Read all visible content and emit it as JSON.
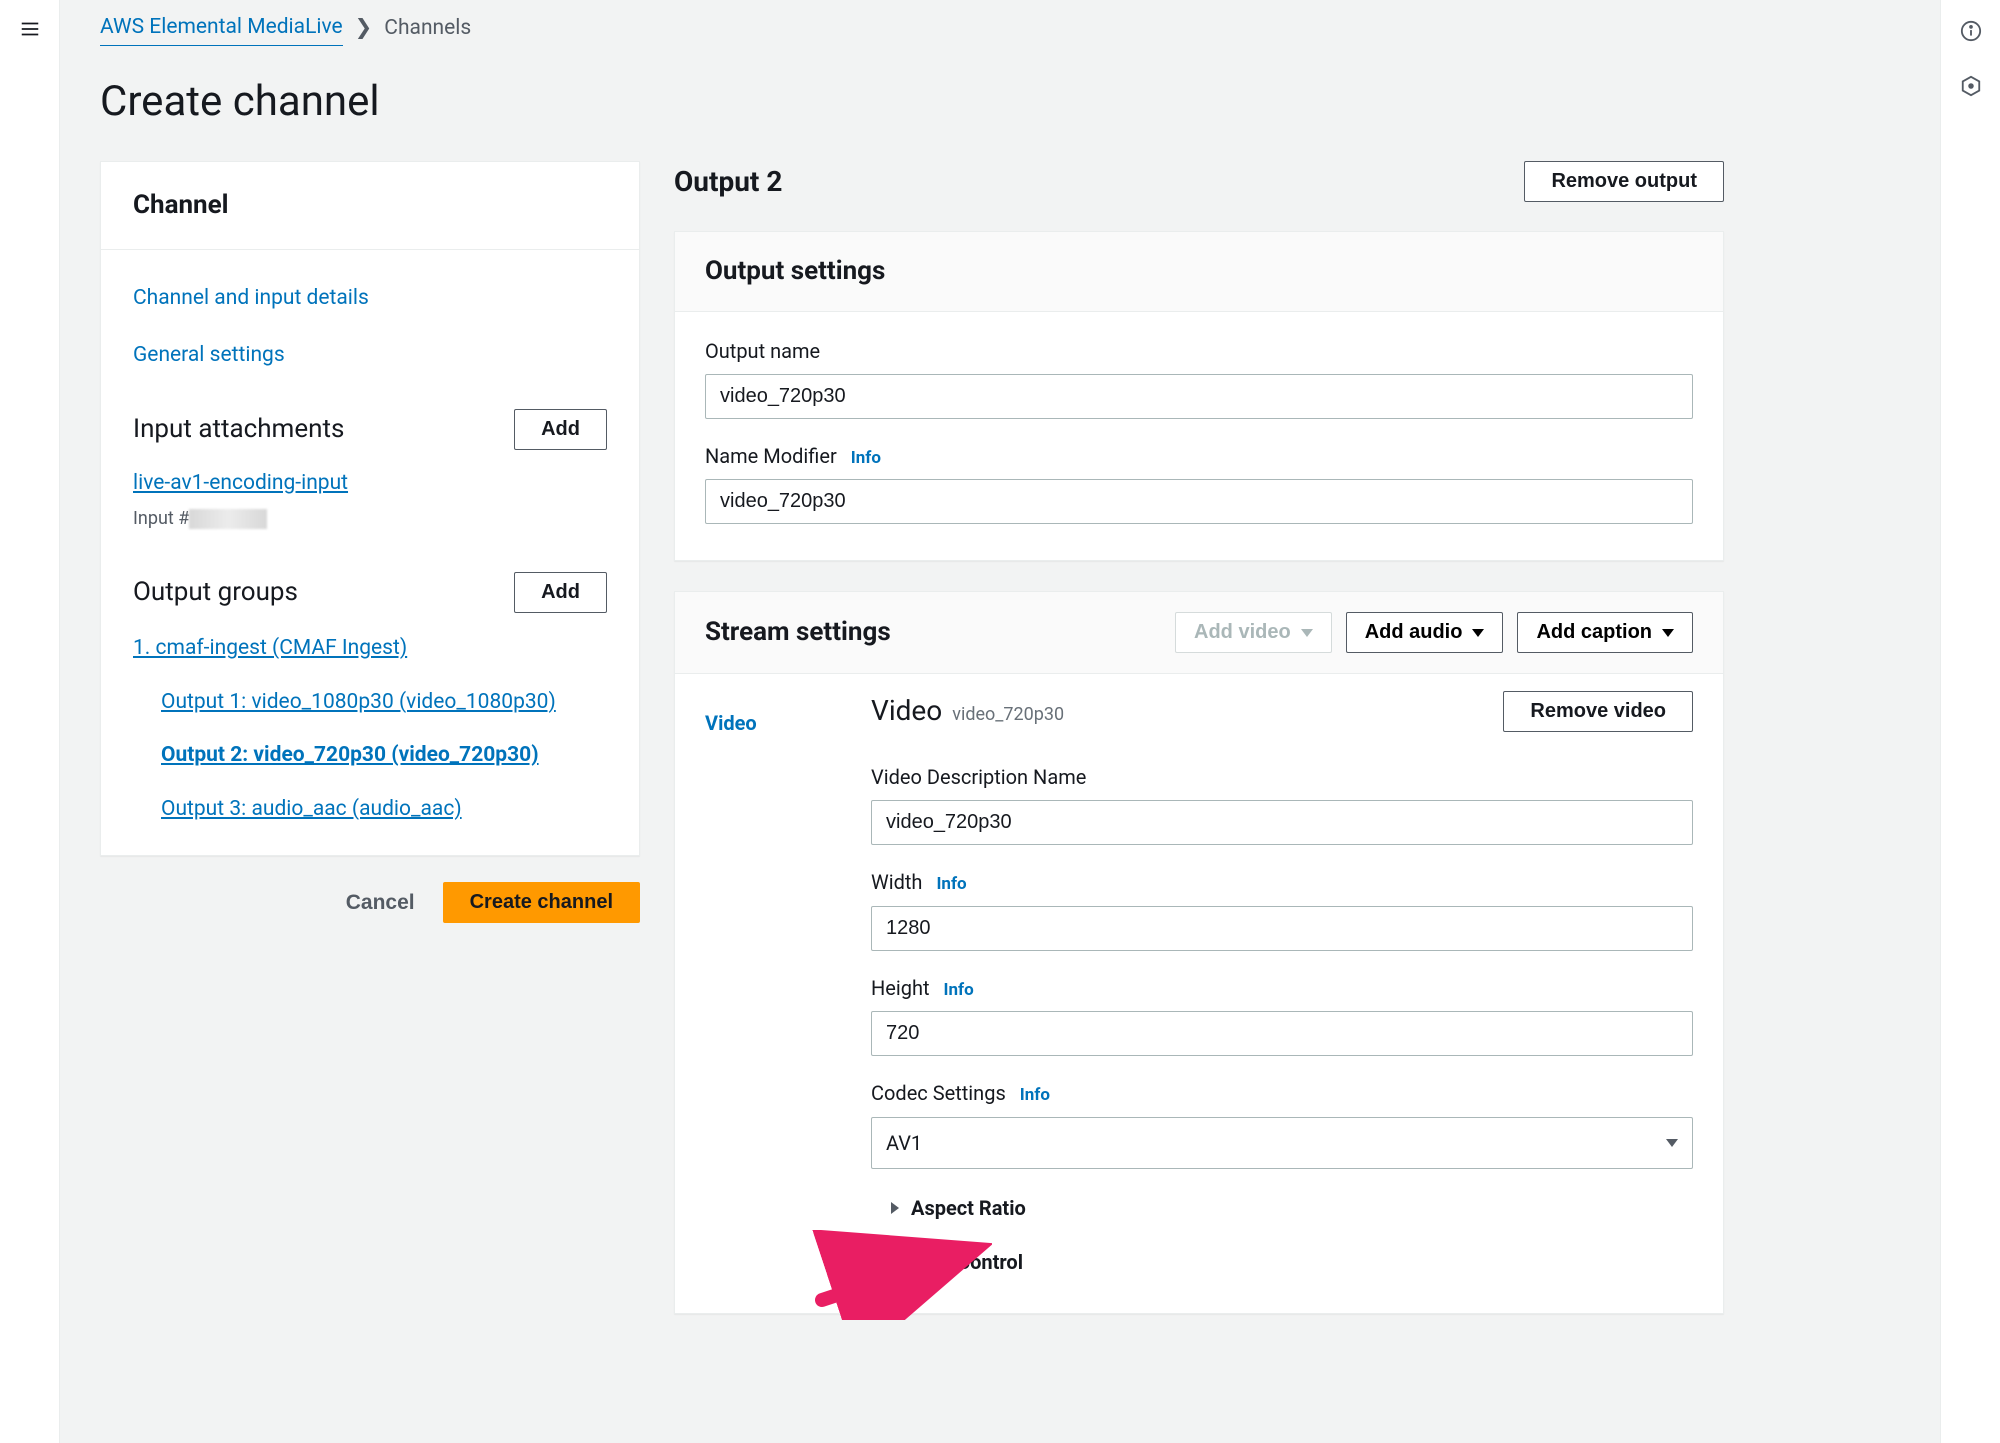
{
  "breadcrumb": {
    "root": "AWS Elemental MediaLive",
    "current": "Channels"
  },
  "page_title": "Create channel",
  "sidebar": {
    "channel_header": "Channel",
    "links": {
      "channel_details": "Channel and input details",
      "general_settings": "General settings"
    },
    "input_attachments": {
      "title": "Input attachments",
      "add_label": "Add",
      "item_name": "live-av1-encoding-input",
      "item_meta_prefix": "Input #"
    },
    "output_groups": {
      "title": "Output groups",
      "add_label": "Add",
      "group": "1. cmaf-ingest (CMAF Ingest)",
      "outputs": [
        "Output 1: video_1080p30 (video_1080p30)",
        "Output 2: video_720p30 (video_720p30)",
        "Output 3: audio_aac (audio_aac)"
      ]
    }
  },
  "footer": {
    "cancel": "Cancel",
    "create": "Create channel"
  },
  "detail": {
    "title": "Output 2",
    "remove_output": "Remove output",
    "output_settings": {
      "heading": "Output settings",
      "output_name_label": "Output name",
      "output_name_value": "video_720p30",
      "name_modifier_label": "Name Modifier",
      "name_modifier_value": "video_720p30",
      "info": "Info"
    },
    "stream_settings": {
      "heading": "Stream settings",
      "add_video": "Add video",
      "add_audio": "Add audio",
      "add_caption": "Add caption",
      "video_tab": "Video",
      "video_heading": "Video",
      "video_heading_suffix": "video_720p30",
      "remove_video": "Remove video",
      "desc_name_label": "Video Description Name",
      "desc_name_value": "video_720p30",
      "width_label": "Width",
      "width_value": "1280",
      "height_label": "Height",
      "height_value": "720",
      "codec_label": "Codec Settings",
      "codec_value": "AV1",
      "info": "Info",
      "aspect_ratio": "Aspect Ratio",
      "rate_control": "Rate Control"
    }
  }
}
